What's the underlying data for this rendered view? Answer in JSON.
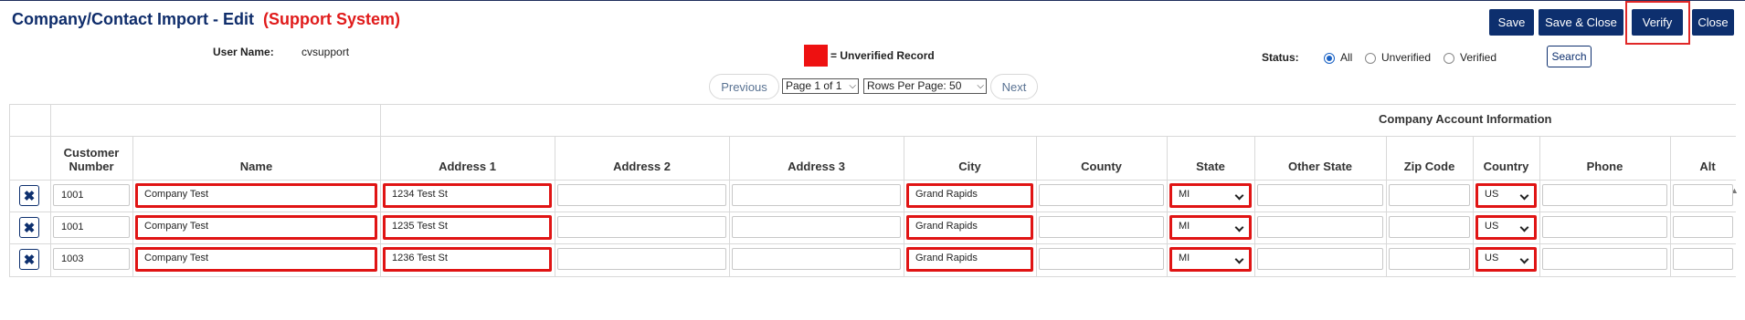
{
  "header": {
    "title": "Company/Contact Import - Edit",
    "system_label": "(Support System)"
  },
  "toolbar": {
    "save": "Save",
    "save_close": "Save & Close",
    "verify": "Verify",
    "close": "Close"
  },
  "user": {
    "label": "User Name:",
    "value": "cvsupport"
  },
  "legend": {
    "text": "= Unverified Record",
    "color": "#ee1111"
  },
  "status": {
    "label": "Status:",
    "options": [
      "All",
      "Unverified",
      "Verified"
    ],
    "selected": "All",
    "search": "Search"
  },
  "pagination": {
    "previous": "Previous",
    "page": "Page 1 of 1",
    "rows_per_page": "Rows Per Page: 50",
    "next": "Next"
  },
  "table": {
    "group_header": "Company Account Information",
    "columns": [
      "Customer Number",
      "Name",
      "Address 1",
      "Address 2",
      "Address 3",
      "City",
      "County",
      "State",
      "Other State",
      "Zip Code",
      "Country",
      "Phone",
      "Alt"
    ],
    "rows": [
      {
        "customer_number": "1001",
        "name": "Company Test",
        "address1": "1234 Test St",
        "address2": "",
        "address3": "",
        "city": "Grand Rapids",
        "county": "",
        "state": "MI",
        "other_state": "",
        "zip": "",
        "country": "US",
        "phone": "",
        "alt": ""
      },
      {
        "customer_number": "1001",
        "name": "Company Test",
        "address1": "1235 Test St",
        "address2": "",
        "address3": "",
        "city": "Grand Rapids",
        "county": "",
        "state": "MI",
        "other_state": "",
        "zip": "",
        "country": "US",
        "phone": "",
        "alt": ""
      },
      {
        "customer_number": "1003",
        "name": "Company Test",
        "address1": "1236 Test St",
        "address2": "",
        "address3": "",
        "city": "Grand Rapids",
        "county": "",
        "state": "MI",
        "other_state": "",
        "zip": "",
        "country": "US",
        "phone": "",
        "alt": ""
      }
    ]
  },
  "icons": {
    "delete": "close-x-icon",
    "scroll_up": "scroll-up-arrow-icon"
  }
}
